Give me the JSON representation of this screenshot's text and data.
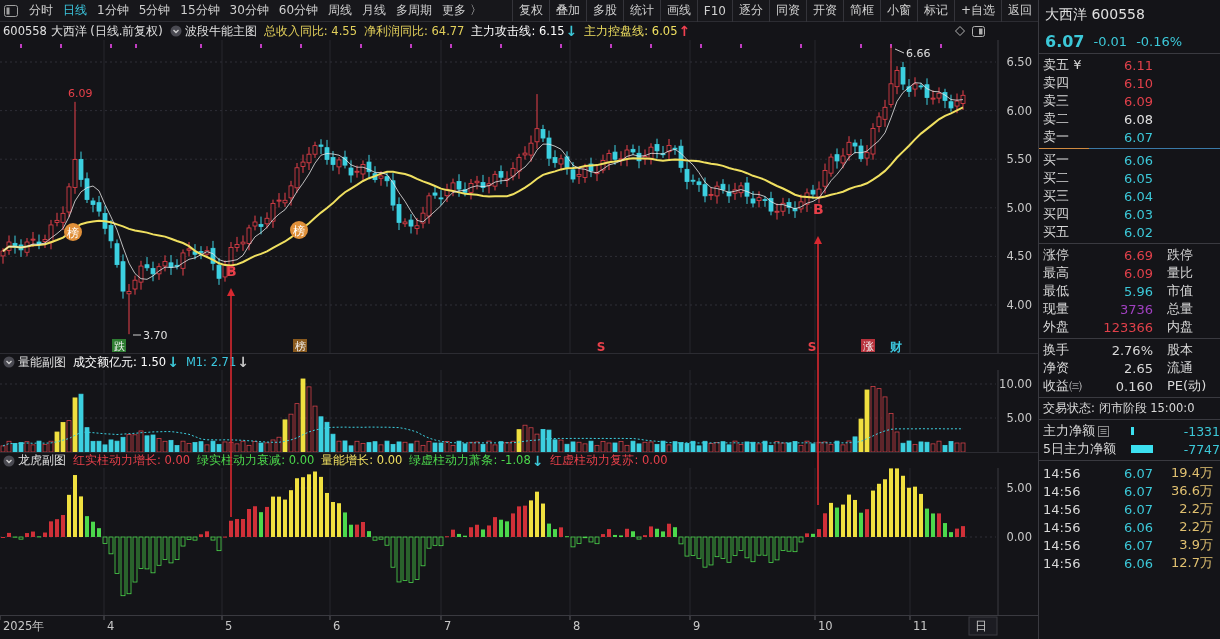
{
  "toolbar": {
    "periods": [
      {
        "label": "分时",
        "selected": false
      },
      {
        "label": "日线",
        "selected": true
      },
      {
        "label": "1分钟",
        "selected": false
      },
      {
        "label": "5分钟",
        "selected": false
      },
      {
        "label": "15分钟",
        "selected": false
      },
      {
        "label": "30分钟",
        "selected": false
      },
      {
        "label": "60分钟",
        "selected": false
      },
      {
        "label": "周线",
        "selected": false
      },
      {
        "label": "月线",
        "selected": false
      },
      {
        "label": "多周期",
        "selected": false
      },
      {
        "label": "更多 〉",
        "selected": false
      }
    ],
    "buttons": [
      "复权",
      "叠加",
      "多股",
      "统计",
      "画线",
      "F10",
      "逐分",
      "同资",
      "开资",
      "简框",
      "小窗",
      "标记",
      "+自选",
      "返回"
    ]
  },
  "main_chart": {
    "stock": "600558 大西洋 (日线.前复权)",
    "indicator": "波段牛能主图",
    "metrics": [
      {
        "text": "总收入同比: 4.55",
        "color": "#e2cf5a"
      },
      {
        "text": "净利润同比: 64.77",
        "color": "#e2cf5a"
      },
      {
        "text": "主力攻击线: 6.15",
        "color": "#ffffff",
        "arrow": {
          "text": "↓",
          "color": "#3cc8d8"
        }
      },
      {
        "text": "主力控盘线: 6.05",
        "color": "#f0e060",
        "arrow": {
          "text": "↑",
          "color": "#f04050"
        }
      }
    ],
    "y_ticks": [
      "6.50",
      "6.00",
      "5.50",
      "5.00",
      "4.50",
      "4.00"
    ],
    "price_labels": [
      "6.09",
      "3.70",
      "6.66"
    ],
    "buy_signals": [
      "B",
      "B"
    ],
    "badges": [
      "榜",
      "榜"
    ],
    "event_markers": [
      {
        "text": "跌",
        "kind": "filled",
        "color": "#2e7d32"
      },
      {
        "text": "榜",
        "kind": "filled",
        "color": "#8a5a1e"
      },
      {
        "text": "S",
        "kind": "plain",
        "color": "#e8404a"
      },
      {
        "text": "S",
        "kind": "plain",
        "color": "#e8404a"
      },
      {
        "text": "涨",
        "kind": "filled",
        "color": "#b8323c"
      },
      {
        "text": "财",
        "kind": "plain",
        "color": "#3cc8e0"
      }
    ]
  },
  "volume_panel": {
    "title": "量能副图",
    "metrics": [
      {
        "text": "成交额亿元: 1.50",
        "color": "#ffffff",
        "arrow": {
          "text": "↓",
          "color": "#3cc8d8"
        }
      },
      {
        "text": "M1: 2.71",
        "color": "#3cc8e0",
        "arrow": {
          "text": "↓",
          "color": "#c8c8c8"
        }
      }
    ],
    "y_ticks": [
      "10.00",
      "5.00"
    ]
  },
  "indicator_panel": {
    "title": "龙虎副图",
    "metrics": [
      {
        "text": "红实柱动力增长: 0.00",
        "color": "#e8404a"
      },
      {
        "text": "绿实柱动力衰减: 0.00",
        "color": "#4cd84c"
      },
      {
        "text": "量能增长: 0.00",
        "color": "#f0e060"
      },
      {
        "text": "绿虚柱动力萧条: -1.08",
        "color": "#4cd84c",
        "arrow": {
          "text": "↓",
          "color": "#3cc8d8"
        }
      },
      {
        "text": "红虚柱动力复苏: 0.00",
        "color": "#e8404a"
      }
    ],
    "y_ticks": [
      "5.00",
      "0.00"
    ]
  },
  "x_axis": {
    "labels": [
      "2025年",
      "4",
      "5",
      "6",
      "7",
      "8",
      "9",
      "10",
      "11"
    ],
    "end": "日"
  },
  "quote": {
    "name": "大西洋 600558",
    "price": "6.07",
    "change": "-0.01",
    "change_pct": "-0.16%",
    "asks": [
      {
        "label": "卖五 ¥",
        "price": "6.11",
        "color": "#e0404a"
      },
      {
        "label": "卖四",
        "price": "6.10",
        "color": "#e0404a"
      },
      {
        "label": "卖三",
        "price": "6.09",
        "color": "#e0404a"
      },
      {
        "label": "卖二",
        "price": "6.08",
        "color": "#e0e0e0"
      },
      {
        "label": "卖一",
        "price": "6.07",
        "color": "#3cc8d8"
      }
    ],
    "bids": [
      {
        "label": "买一",
        "price": "6.06",
        "color": "#3cc8d8"
      },
      {
        "label": "买二",
        "price": "6.05",
        "color": "#3cc8d8"
      },
      {
        "label": "买三",
        "price": "6.04",
        "color": "#3cc8d8"
      },
      {
        "label": "买四",
        "price": "6.03",
        "color": "#3cc8d8"
      },
      {
        "label": "买五",
        "price": "6.02",
        "color": "#3cc8d8"
      }
    ],
    "stats": [
      {
        "label": "涨停",
        "value": "6.69",
        "color": "#e0404a",
        "label2": "跌停"
      },
      {
        "label": "最高",
        "value": "6.09",
        "color": "#e0404a",
        "label2": "量比"
      },
      {
        "label": "最低",
        "value": "5.96",
        "color": "#3cc8d8",
        "label2": "市值"
      },
      {
        "label": "现量",
        "value": "3736",
        "color": "#a040c0",
        "label2": "总量"
      },
      {
        "label": "外盘",
        "value": "123366",
        "color": "#e0404a",
        "label2": "内盘"
      }
    ],
    "fundamentals": [
      {
        "label": "换手",
        "value": "2.76%",
        "label2": "股本"
      },
      {
        "label": "净资",
        "value": "2.65",
        "label2": "流通"
      },
      {
        "label": "收益㈢",
        "value": "0.160",
        "label2": "PE(动)"
      }
    ],
    "status": "交易状态: 闭市阶段 15:00:0",
    "flows": [
      {
        "label": "主力净额",
        "value": "-1331"
      },
      {
        "label": "5日主力净额",
        "value": "-7747"
      }
    ],
    "trades": [
      {
        "time": "14:56",
        "price": "6.07",
        "volume": "19.4万"
      },
      {
        "time": "14:56",
        "price": "6.07",
        "volume": "36.6万"
      },
      {
        "time": "14:56",
        "price": "6.07",
        "volume": "2.2万"
      },
      {
        "time": "14:56",
        "price": "6.06",
        "volume": "2.2万"
      },
      {
        "time": "14:56",
        "price": "6.07",
        "volume": "3.9万"
      },
      {
        "time": "14:56",
        "price": "6.06",
        "volume": "12.7万"
      }
    ]
  }
}
